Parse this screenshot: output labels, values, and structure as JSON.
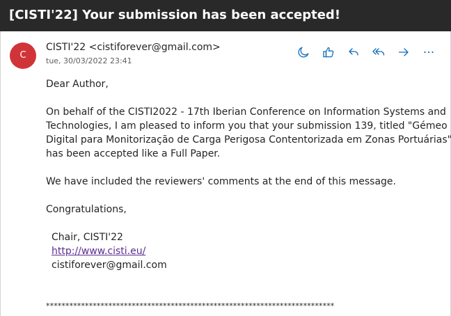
{
  "email": {
    "subject": "[CISTI'22] Your submission has been accepted!",
    "sender_initial": "C",
    "sender_name": "CISTI'22",
    "sender_email": "<cistiforever@gmail.com>",
    "date": "tue, 30/03/2022 23:41",
    "avatar_color": "#d13438",
    "accent_color": "#0f6cbd"
  },
  "actions": [
    {
      "icon": "moon-icon",
      "label": "Immersive reader"
    },
    {
      "icon": "thumbs-up-icon",
      "label": "Like"
    },
    {
      "icon": "reply-icon",
      "label": "Reply"
    },
    {
      "icon": "reply-all-icon",
      "label": "Reply all"
    },
    {
      "icon": "forward-icon",
      "label": "Forward"
    },
    {
      "icon": "more-icon",
      "label": "More actions"
    }
  ],
  "body": {
    "greeting": "Dear Author,",
    "para1_line1": "On behalf of the CISTI2022 - 17th Iberian Conference on Information Systems and",
    "para1_line2": "Technologies, I am pleased to inform you that your submission 139, titled \"Gémeo",
    "para1_line3": "Digital para Monitorização de Carga Perigosa Contentorizada em Zonas Portuárias\"",
    "para1_line4": "has been accepted like a Full Paper.",
    "para2": "We have included the reviewers' comments at the end of this message.",
    "congrats": "Congratulations,",
    "sig_chair": "Chair, CISTI'22",
    "sig_link": "http://www.cisti.eu/",
    "sig_email": "cistiforever@gmail.com",
    "separator": "**************************************************************************"
  }
}
